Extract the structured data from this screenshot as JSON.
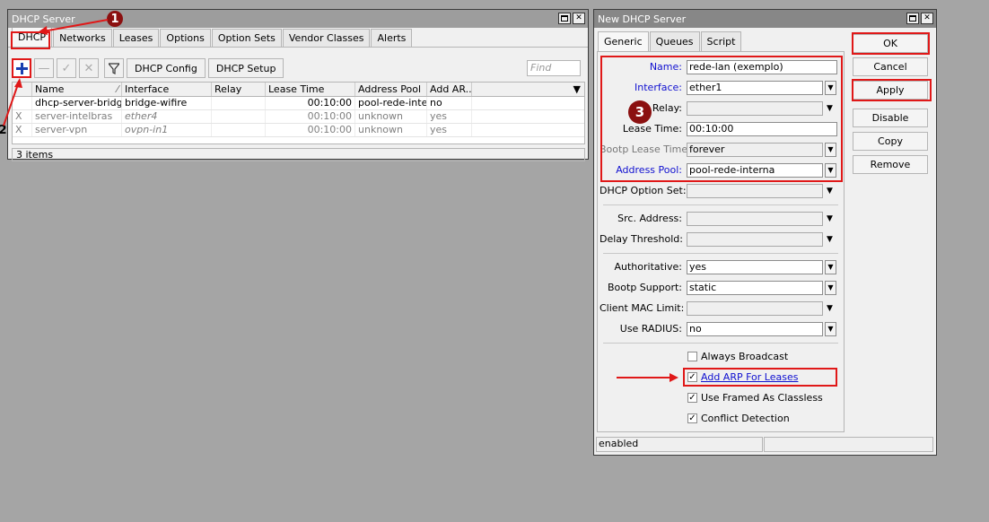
{
  "dhcp_window": {
    "title": "DHCP Server",
    "tabs": [
      "DHCP",
      "Networks",
      "Leases",
      "Options",
      "Option Sets",
      "Vendor Classes",
      "Alerts"
    ],
    "toolbar": {
      "add_icon": "plus-icon",
      "remove_icon": "minus-icon",
      "enable_icon": "check-icon",
      "disable_icon": "x-icon",
      "filter_icon": "filter-icon",
      "dhcp_config": "DHCP Config",
      "dhcp_setup": "DHCP Setup"
    },
    "find_placeholder": "Find",
    "columns": [
      "Name",
      "Interface",
      "Relay",
      "Lease Time",
      "Address Pool",
      "Add AR..."
    ],
    "rows": [
      {
        "flag": "",
        "name": "dhcp-server-bridg...",
        "interface": "bridge-wifire",
        "relay": "",
        "lease_time": "00:10:00",
        "address_pool": "pool-rede-inte...",
        "add_arp": "no",
        "disabled": false
      },
      {
        "flag": "X",
        "name": "server-intelbras",
        "interface": "ether4",
        "relay": "",
        "lease_time": "00:10:00",
        "address_pool": "unknown",
        "add_arp": "yes",
        "disabled": true
      },
      {
        "flag": "X",
        "name": "server-vpn",
        "interface": "ovpn-in1",
        "relay": "",
        "lease_time": "00:10:00",
        "address_pool": "unknown",
        "add_arp": "yes",
        "disabled": true
      }
    ],
    "status": "3 items"
  },
  "new_window": {
    "title": "New DHCP Server",
    "tabs": [
      "Generic",
      "Queues",
      "Script"
    ],
    "fields": {
      "name": {
        "label": "Name:",
        "value": "rede-lan (exemplo)"
      },
      "interface": {
        "label": "Interface:",
        "value": "ether1"
      },
      "relay": {
        "label": "Relay:",
        "value": ""
      },
      "lease_time": {
        "label": "Lease Time:",
        "value": "00:10:00"
      },
      "bootp_lease_time": {
        "label": "Bootp Lease Time:",
        "value": "forever"
      },
      "address_pool": {
        "label": "Address Pool:",
        "value": "pool-rede-interna"
      },
      "dhcp_option_set": {
        "label": "DHCP Option Set:",
        "value": ""
      },
      "src_address": {
        "label": "Src. Address:",
        "value": ""
      },
      "delay_threshold": {
        "label": "Delay Threshold:",
        "value": ""
      },
      "authoritative": {
        "label": "Authoritative:",
        "value": "yes"
      },
      "bootp_support": {
        "label": "Bootp Support:",
        "value": "static"
      },
      "client_mac_limit": {
        "label": "Client MAC Limit:",
        "value": ""
      },
      "use_radius": {
        "label": "Use RADIUS:",
        "value": "no"
      }
    },
    "checkboxes": [
      {
        "label": "Always Broadcast",
        "checked": false
      },
      {
        "label": "Add ARP For Leases",
        "checked": true
      },
      {
        "label": "Use Framed As Classless",
        "checked": true
      },
      {
        "label": "Conflict Detection",
        "checked": true
      }
    ],
    "buttons": [
      "OK",
      "Cancel",
      "Apply",
      "Disable",
      "Copy",
      "Remove"
    ],
    "status": "enabled"
  },
  "annotations": {
    "step1": "1",
    "step2": "2",
    "step3": "3",
    "highlight_color": "#e01818",
    "badge_color": "#8b1010"
  }
}
